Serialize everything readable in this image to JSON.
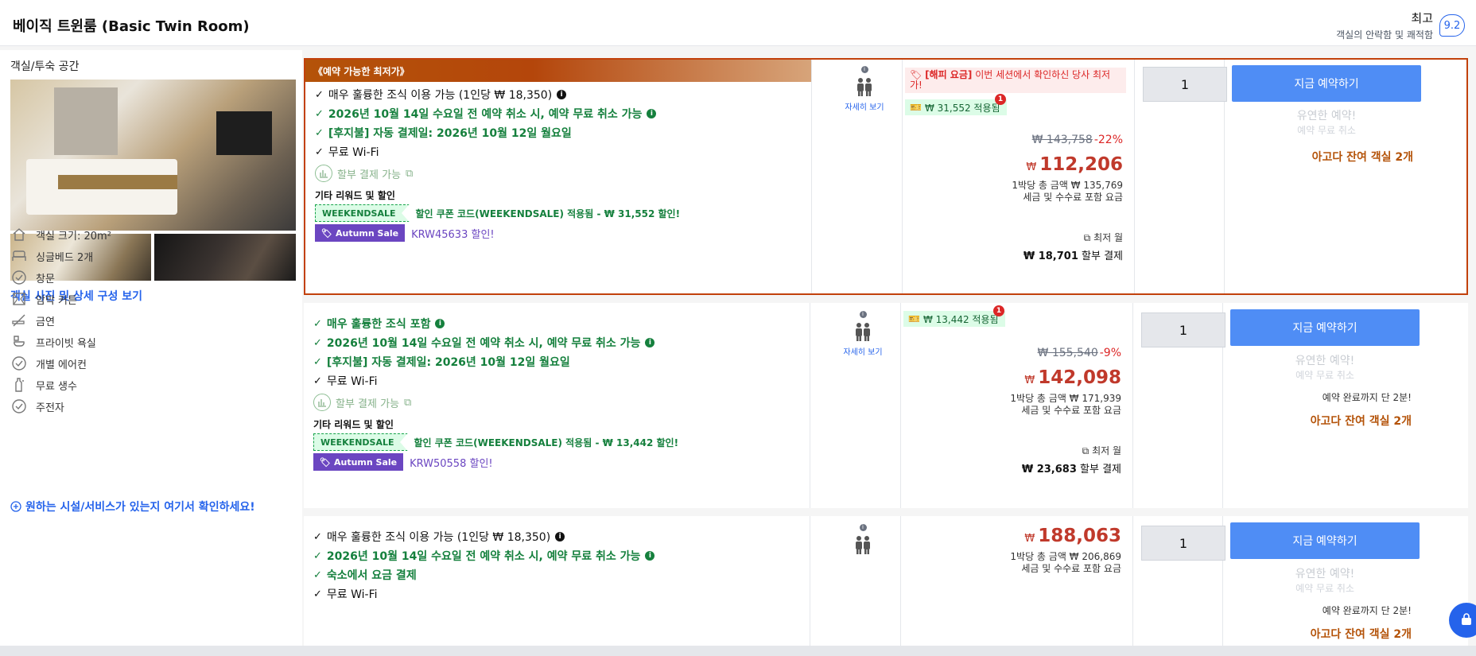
{
  "header": {
    "room_title": "베이직 트윈룸 (Basic Twin Room)",
    "review_word": "최고",
    "review_sub": "객실의 안락함 및 쾌적함",
    "review_score": "9.2"
  },
  "left": {
    "section_title": "객실/투숙 공간",
    "photo_link": "객실 사진 및 상세 구성 보기",
    "amenities": [
      {
        "label": "객실 크기: 20m²",
        "icon": "room-size-icon"
      },
      {
        "label": "싱글베드 2개",
        "icon": "bed-icon"
      },
      {
        "label": "창문",
        "icon": "check-circle-icon"
      },
      {
        "label": "암막 커튼",
        "icon": "curtain-icon"
      },
      {
        "label": "금연",
        "icon": "no-smoking-icon"
      },
      {
        "label": "프라이빗 욕실",
        "icon": "bathroom-icon"
      },
      {
        "label": "개별 에어컨",
        "icon": "check-circle-icon"
      },
      {
        "label": "무료 생수",
        "icon": "water-bottle-icon"
      },
      {
        "label": "주전자",
        "icon": "check-circle-icon"
      }
    ],
    "more_link": "원하는 시설/서비스가 있는지 여기서 확인하세요!"
  },
  "rates": [
    {
      "banner": "《예약 가능한 최저가》",
      "features": [
        {
          "text": "매우 훌륭한 조식 이용 가능 (1인당 ₩ 18,350)",
          "style": "black",
          "info": "black"
        },
        {
          "text": "2026년 10월 14일 수요일 전 예약 취소 시, 예약 무료 취소 가능",
          "style": "green",
          "info": "green"
        },
        {
          "text": "[후지불] 자동 결제일: 2026년 10월 12일 월요일",
          "style": "green",
          "info": ""
        },
        {
          "text": "무료 Wi-Fi",
          "style": "black",
          "info": ""
        }
      ],
      "installment": "할부 결제 가능",
      "other_head": "기타 리워드 및 할인",
      "coupon_tag": "WEEKENDSALE",
      "coupon_text": "할인 쿠폰 코드(WEEKENDSALE) 적용됨 - ₩ 31,552 할인!",
      "sale_badge": "Autumn Sale",
      "sale_code": "KRW45633 할인!",
      "occupancy_link": "자세히 보기",
      "happy_label": "[해피 요금]",
      "happy_text": "이번 세션에서 확인하신 당사 최저가!",
      "cashback": "₩ 31,552 적용됨",
      "cashback_count": "1",
      "old_price": "₩ 143,758",
      "discount": "-22%",
      "currency": "₩",
      "price": "112,206",
      "total_line": "1박당 총 금액 ₩ 135,769",
      "tax_line": "세금 및 수수료 포함 요금",
      "monthly_label": "최저 월",
      "monthly_amount": "₩ 18,701",
      "monthly_suffix": "할부 결제",
      "qty": "1",
      "book": "지금 예약하기",
      "flex_title": "유연한 예약!",
      "flex_sub": "예약 무료 취소",
      "until": "",
      "remain": "아고다 잔여 객실 2개"
    },
    {
      "features": [
        {
          "text": "매우 훌륭한 조식 포함",
          "style": "green",
          "info": "green"
        },
        {
          "text": "2026년 10월 14일 수요일 전 예약 취소 시, 예약 무료 취소 가능",
          "style": "green",
          "info": "green"
        },
        {
          "text": "[후지불] 자동 결제일: 2026년 10월 12일 월요일",
          "style": "green",
          "info": ""
        },
        {
          "text": "무료 Wi-Fi",
          "style": "black",
          "info": ""
        }
      ],
      "installment": "할부 결제 가능",
      "other_head": "기타 리워드 및 할인",
      "coupon_tag": "WEEKENDSALE",
      "coupon_text": "할인 쿠폰 코드(WEEKENDSALE) 적용됨 - ₩ 13,442 할인!",
      "sale_badge": "Autumn Sale",
      "sale_code": "KRW50558 할인!",
      "occupancy_link": "자세히 보기",
      "cashback": "₩ 13,442 적용됨",
      "cashback_count": "1",
      "old_price": "₩ 155,540",
      "discount": "-9%",
      "currency": "₩",
      "price": "142,098",
      "total_line": "1박당 총 금액 ₩ 171,939",
      "tax_line": "세금 및 수수료 포함 요금",
      "monthly_label": "최저 월",
      "monthly_amount": "₩ 23,683",
      "monthly_suffix": "할부 결제",
      "qty": "1",
      "book": "지금 예약하기",
      "flex_title": "유연한 예약!",
      "flex_sub": "예약 무료 취소",
      "until": "예약 완료까지 단 2분!",
      "remain": "아고다 잔여 객실 2개"
    },
    {
      "features": [
        {
          "text": "매우 훌륭한 조식 이용 가능 (1인당 ₩ 18,350)",
          "style": "black",
          "info": "black"
        },
        {
          "text": "2026년 10월 14일 수요일 전 예약 취소 시, 예약 무료 취소 가능",
          "style": "green",
          "info": "green"
        },
        {
          "text": "숙소에서 요금 결제",
          "style": "green",
          "info": ""
        },
        {
          "text": "무료 Wi-Fi",
          "style": "black",
          "info": ""
        }
      ],
      "currency": "₩",
      "price": "188,063",
      "total_line": "1박당 총 금액 ₩ 206,869",
      "tax_line": "세금 및 수수료 포함 요금",
      "qty": "1",
      "book": "지금 예약하기",
      "flex_title": "유연한 예약!",
      "flex_sub": "예약 무료 취소",
      "until": "예약 완료까지 단 2분!",
      "remain": "아고다 잔여 객실 2개"
    }
  ],
  "colors": {
    "accent": "#4f8df5",
    "price": "#c0392b",
    "green": "#15803d",
    "orange": "#b45309",
    "purple": "#6b46c1"
  }
}
